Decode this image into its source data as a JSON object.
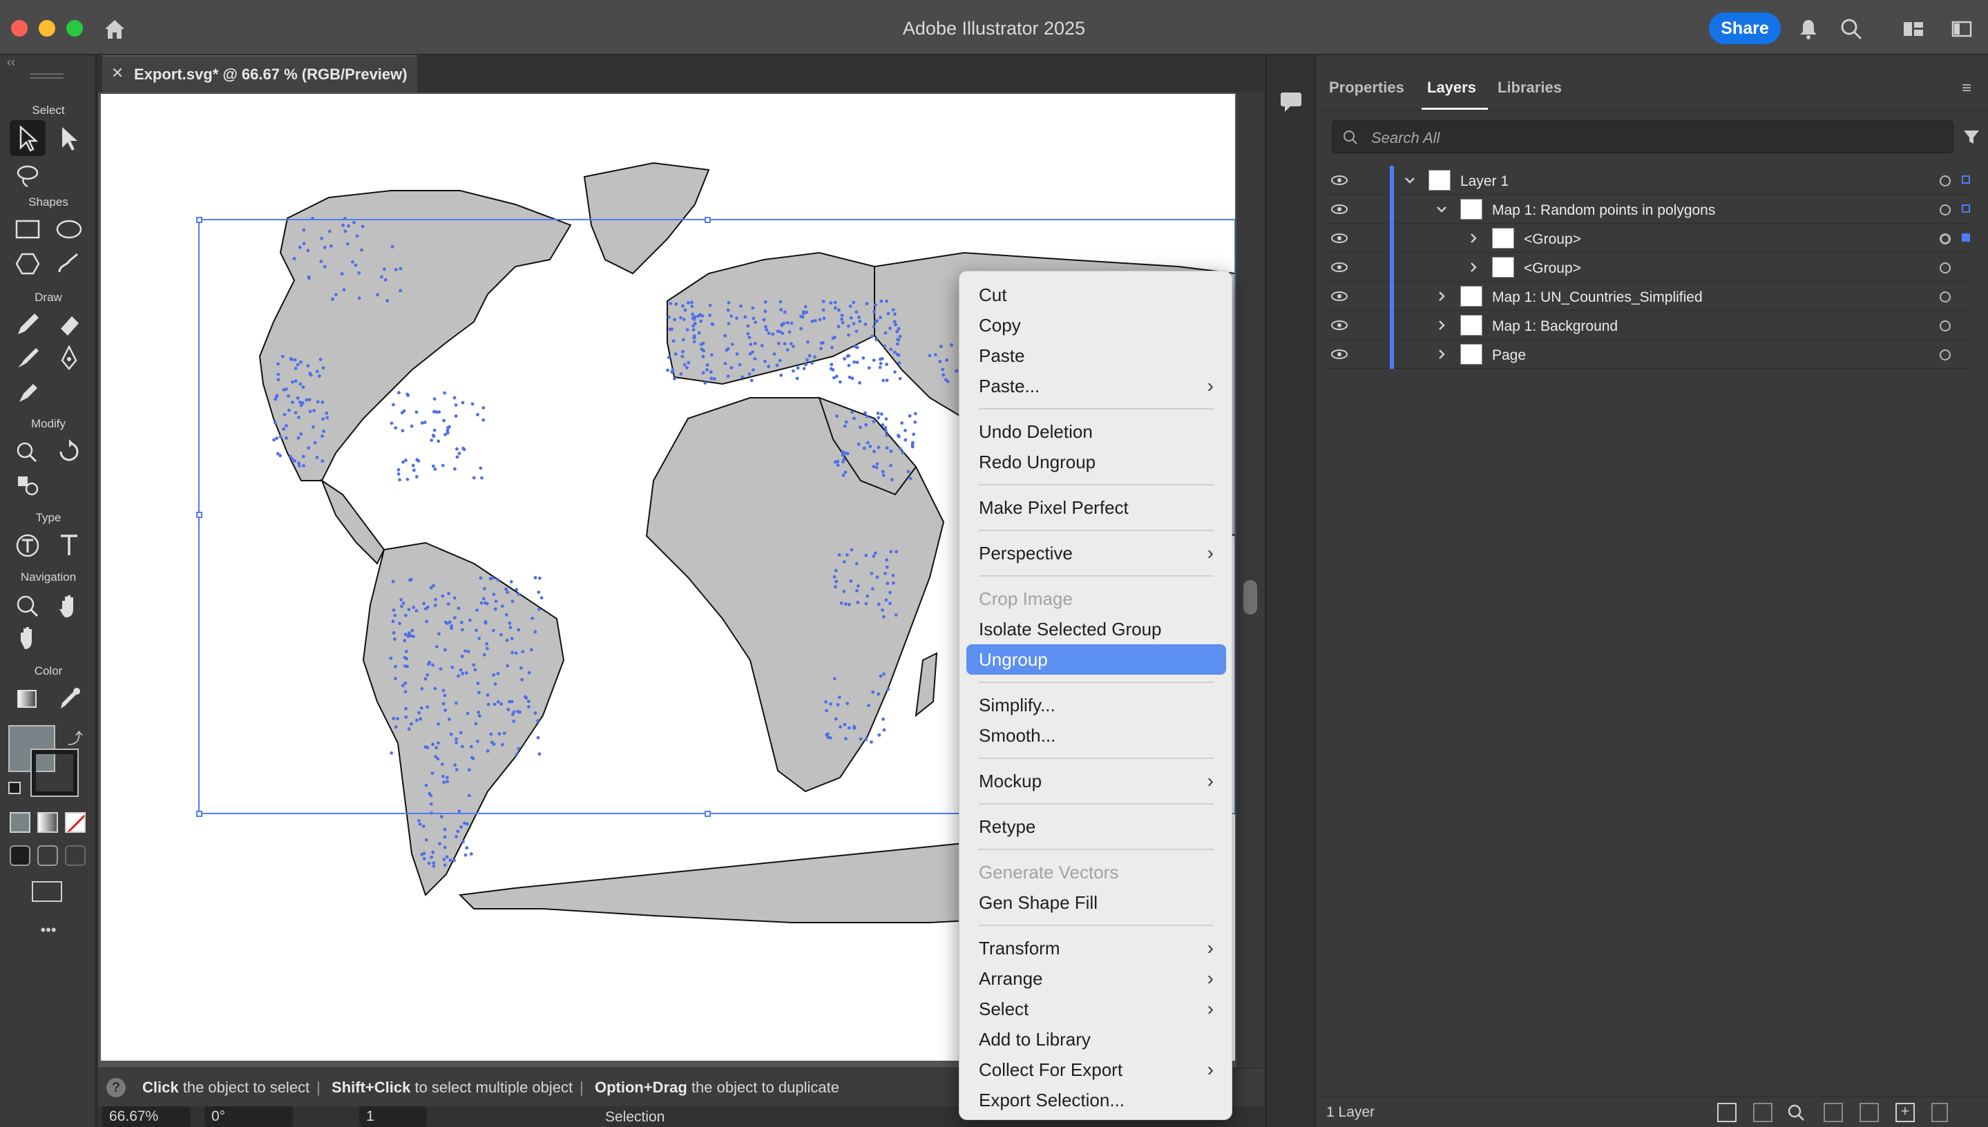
{
  "app": {
    "title": "Adobe Illustrator 2025",
    "share_label": "Share"
  },
  "document_tab": {
    "label": "Export.svg* @ 66.67 % (RGB/Preview)"
  },
  "toolbar": {
    "sections": {
      "select": "Select",
      "shapes": "Shapes",
      "draw": "Draw",
      "modify": "Modify",
      "type": "Type",
      "navigation": "Navigation",
      "color": "Color"
    },
    "more": "•••"
  },
  "hint": {
    "part1_bold": "Click",
    "part1": "the object to select",
    "part2_bold": "Shift+Click",
    "part2": "to select multiple object",
    "part3_bold": "Option+Drag",
    "part3": "the object to duplicate"
  },
  "bottom": {
    "zoom": "66.67%",
    "rotation": "0°",
    "artboard": "1",
    "tool": "Selection"
  },
  "panel": {
    "tabs": [
      "Properties",
      "Layers",
      "Libraries"
    ],
    "active_tab": "Layers",
    "search_placeholder": "Search All",
    "layers": [
      {
        "label": "Layer 1",
        "expanded": true
      },
      {
        "label": "Map 1: Random points in polygons",
        "expanded": true
      },
      {
        "label": "<Group>",
        "expanded": false
      },
      {
        "label": "<Group>",
        "expanded": false
      },
      {
        "label": "Map 1: UN_Countries_Simplified",
        "expanded": false
      },
      {
        "label": "Map 1: Background",
        "expanded": false
      },
      {
        "label": "Page",
        "expanded": false
      }
    ],
    "footer": "1 Layer",
    "accent": "#4f7cf7"
  },
  "context_menu": {
    "items": [
      {
        "label": "Cut"
      },
      {
        "label": "Copy"
      },
      {
        "label": "Paste"
      },
      {
        "label": "Paste...",
        "submenu": true
      },
      {
        "label": "Undo Deletion"
      },
      {
        "label": "Redo Ungroup"
      },
      {
        "label": "Make Pixel Perfect"
      },
      {
        "label": "Perspective",
        "submenu": true
      },
      {
        "label": "Crop Image",
        "disabled": true
      },
      {
        "label": "Isolate Selected Group"
      },
      {
        "label": "Ungroup",
        "highlighted": true
      },
      {
        "label": "Simplify..."
      },
      {
        "label": "Smooth..."
      },
      {
        "label": "Mockup",
        "submenu": true
      },
      {
        "label": "Retype"
      },
      {
        "label": "Generate Vectors",
        "disabled": true
      },
      {
        "label": "Gen Shape Fill"
      },
      {
        "label": "Transform",
        "submenu": true
      },
      {
        "label": "Arrange",
        "submenu": true
      },
      {
        "label": "Select",
        "submenu": true
      },
      {
        "label": "Add to Library"
      },
      {
        "label": "Collect For Export",
        "submenu": true
      },
      {
        "label": "Export Selection..."
      }
    ],
    "highlight_color": "#5b8ff0"
  },
  "map": {
    "land_color": "#c0c0c0",
    "point_color": "#4f6fe8"
  }
}
